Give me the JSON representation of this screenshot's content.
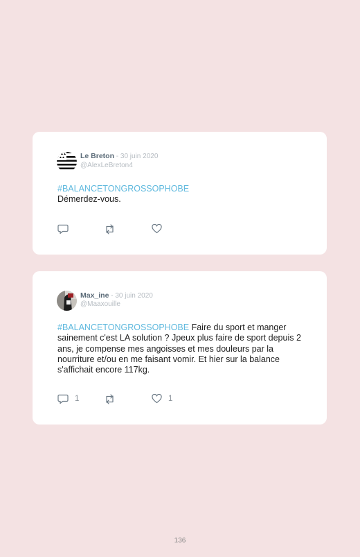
{
  "tweets": [
    {
      "author_name": "Le Breton",
      "date": " - 30 juin 2020",
      "handle": "@AlexLeBreton4",
      "hashtag": "#BALANCETONGROSSOPHOBE",
      "text": "Démerdez-vous.",
      "replies": "",
      "retweets": "",
      "likes": "",
      "avatar_icon": "breton-flag-icon"
    },
    {
      "author_name": "Max_ine",
      "date": " - 30 juin 2020",
      "handle": "@Maaxouille",
      "hashtag": "#BALANCETONGROSSOPHOBE",
      "text": " Faire du sport et manger sainement c'est LA solution ? Jpeux plus faire de sport depuis 2 ans, je compense mes angoisses et mes douleurs par la nourriture et/ou en me faisant vomir. Et hier sur la balance s'affichait encore 117kg.",
      "replies": "1",
      "retweets": "",
      "likes": "1",
      "avatar_icon": "profile-photo"
    }
  ],
  "page": {
    "number": "136"
  },
  "colors": {
    "background": "#f4e2e3",
    "card": "#ffffff",
    "hashtag": "#5fb9de",
    "icon": "#6c7a86"
  }
}
